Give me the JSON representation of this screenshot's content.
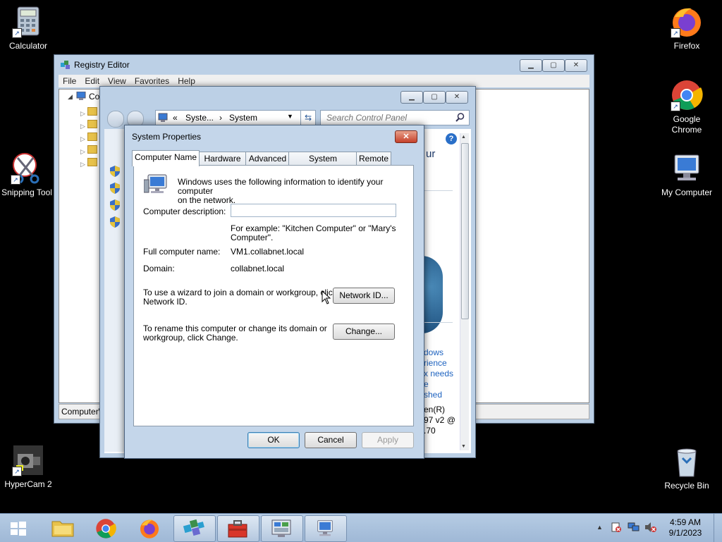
{
  "desktop": {
    "icons": [
      {
        "label": "Calculator",
        "icon": "calculator-icon"
      },
      {
        "label": "Snipping Tool",
        "icon": "scissors-icon"
      },
      {
        "label": "HyperCam 2",
        "icon": "camera-icon"
      },
      {
        "label": "Firefox",
        "icon": "firefox-icon"
      },
      {
        "label": "Google Chrome",
        "icon": "chrome-icon"
      },
      {
        "label": "My Computer",
        "icon": "computer-icon"
      },
      {
        "label": "Recycle Bin",
        "icon": "recycle-bin-icon"
      }
    ]
  },
  "regedit": {
    "title": "Registry Editor",
    "menu": [
      "File",
      "Edit",
      "View",
      "Favorites",
      "Help"
    ],
    "tree_root": "Co",
    "status": "Computer\\"
  },
  "control_panel": {
    "address_prefix": "«",
    "address_part1": "Syste...",
    "address_sep": "›",
    "address_part2": "System",
    "search_placeholder": "Search Control Panel",
    "peek": {
      "heading": "ur",
      "link1": "dows",
      "link2": "rience",
      "link3": "x needs",
      "link4": "e",
      "link5": "shed",
      "cpu1": "en(R)",
      "cpu2": "97 v2 @",
      "cpu3": ".70"
    }
  },
  "system_properties": {
    "title": "System Properties",
    "tabs": [
      "Computer Name",
      "Hardware",
      "Advanced",
      "System Protection",
      "Remote"
    ],
    "intro_line1": "Windows uses the following information to identify your computer",
    "intro_line2": "on the network.",
    "description_label": "Computer description:",
    "description_value": "",
    "example_line1": "For example: \"Kitchen Computer\" or \"Mary's",
    "example_line2": "Computer\".",
    "full_name_label": "Full computer name:",
    "full_name_value": "VM1.collabnet.local",
    "domain_label": "Domain:",
    "domain_value": "collabnet.local",
    "wizard_line1": "To use a wizard to join a domain or workgroup, click",
    "wizard_line2": "Network ID.",
    "network_id_button": "Network ID...",
    "rename_line1": "To rename this computer or change its domain or",
    "rename_line2": "workgroup, click Change.",
    "change_button": "Change...",
    "ok_button": "OK",
    "cancel_button": "Cancel",
    "apply_button": "Apply"
  },
  "taskbar": {
    "time": "4:59 AM",
    "date": "9/1/2023"
  }
}
